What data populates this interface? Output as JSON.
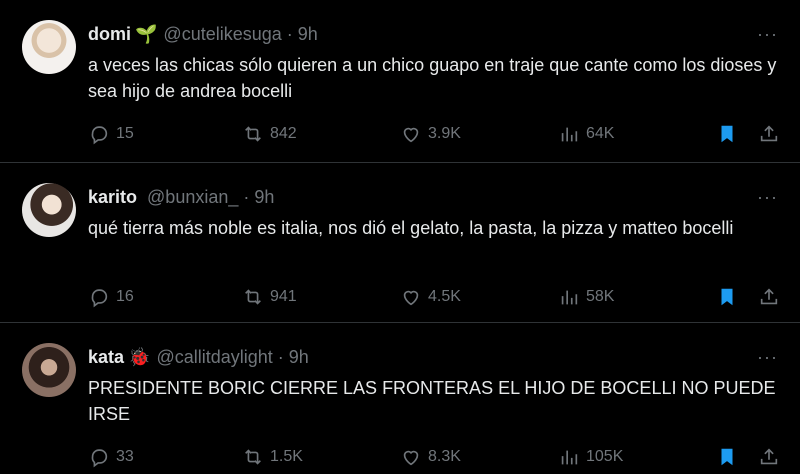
{
  "tweets": [
    {
      "name": "domi",
      "emoji": "🌱",
      "handle": "@cutelikesuga",
      "dot": "·",
      "time": "9h",
      "more": "···",
      "text": "a veces las chicas sólo quieren a un chico guapo en traje que cante como los dioses y sea hijo de andrea bocelli",
      "replies": "15",
      "retweets": "842",
      "likes": "3.9K",
      "views": "64K"
    },
    {
      "name": "karito",
      "emoji": "",
      "handle": "@bunxian_",
      "dot": "·",
      "time": "9h",
      "more": "···",
      "text": "qué tierra más noble es italia, nos dió el gelato, la pasta, la pizza y matteo bocelli",
      "replies": "16",
      "retweets": "941",
      "likes": "4.5K",
      "views": "58K"
    },
    {
      "name": "kata",
      "emoji": "🐞",
      "handle": "@callitdaylight",
      "dot": "·",
      "time": "9h",
      "more": "···",
      "text": "PRESIDENTE BORIC CIERRE LAS FRONTERAS EL HIJO DE BOCELLI NO PUEDE IRSE",
      "replies": "33",
      "retweets": "1.5K",
      "likes": "8.3K",
      "views": "105K"
    }
  ],
  "colors": {
    "background": "#000000",
    "text": "#e7e9ea",
    "muted": "#71767b",
    "bookmark_active": "#1d9bf0",
    "divider": "#2f3336"
  },
  "icons": [
    "reply-icon",
    "retweet-icon",
    "like-icon",
    "views-icon",
    "bookmark-icon",
    "share-icon",
    "more-icon"
  ]
}
